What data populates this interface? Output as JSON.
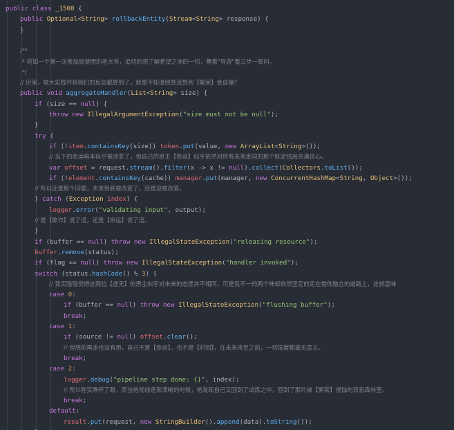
{
  "colors": {
    "background": "#282c34",
    "keyword": "#c678dd",
    "type": "#e5c07b",
    "function": "#61afef",
    "string": "#98c379",
    "comment": "#7f848e",
    "number": "#d19a66",
    "plain": "#abb2bf",
    "identifier": "#e06c75"
  },
  "code_lines": [
    {
      "indent": 0,
      "tokens": [
        {
          "t": "kw",
          "v": "public class "
        },
        {
          "t": "ty",
          "v": "_1500"
        },
        {
          "t": "pl",
          "v": " {"
        }
      ]
    },
    {
      "indent": 1,
      "tokens": [
        {
          "t": "kw",
          "v": "public "
        },
        {
          "t": "ty",
          "v": "Optional"
        },
        {
          "t": "pl",
          "v": "<"
        },
        {
          "t": "ty",
          "v": "String"
        },
        {
          "t": "pl",
          "v": "> "
        },
        {
          "t": "fn",
          "v": "rollbackEntity"
        },
        {
          "t": "pl",
          "v": "("
        },
        {
          "t": "ty",
          "v": "Stream"
        },
        {
          "t": "pl",
          "v": "<"
        },
        {
          "t": "ty",
          "v": "String"
        },
        {
          "t": "pl",
          "v": "> response) {"
        }
      ]
    },
    {
      "indent": 1,
      "tokens": [
        {
          "t": "pl",
          "v": "}"
        }
      ]
    },
    {
      "indent": 0,
      "tokens": []
    },
    {
      "indent": 1,
      "tokens": [
        {
          "t": "cm",
          "v": "/**"
        }
      ]
    },
    {
      "indent": 1,
      "tokens": [
        {
          "t": "cm",
          "v": " * 宛如一个第一次参加旅游团的老大爷，追切的想了解希望之洲的一切，蓦看\"导游\"看三步一顿问。"
        }
      ]
    },
    {
      "indent": 1,
      "tokens": [
        {
          "t": "cm",
          "v": " */"
        }
      ]
    },
    {
      "indent": 1,
      "tokens": [
        {
          "t": "cm",
          "v": "// 厉害，被大实践许将她们的反应都算到了，就是不知道他算没算到【繁荣】会自爆？"
        }
      ]
    },
    {
      "indent": 1,
      "tokens": [
        {
          "t": "kw",
          "v": "public void "
        },
        {
          "t": "fn",
          "v": "aggregateHandler"
        },
        {
          "t": "pl",
          "v": "("
        },
        {
          "t": "ty",
          "v": "List"
        },
        {
          "t": "pl",
          "v": "<"
        },
        {
          "t": "ty",
          "v": "String"
        },
        {
          "t": "pl",
          "v": "> size) {"
        }
      ]
    },
    {
      "indent": 2,
      "tokens": [
        {
          "t": "kw",
          "v": "if "
        },
        {
          "t": "pl",
          "v": "(size == "
        },
        {
          "t": "kw",
          "v": "null"
        },
        {
          "t": "pl",
          "v": ") {"
        }
      ]
    },
    {
      "indent": 3,
      "tokens": [
        {
          "t": "kw",
          "v": "throw new "
        },
        {
          "t": "ty",
          "v": "IllegalArgumentException"
        },
        {
          "t": "pl",
          "v": "("
        },
        {
          "t": "st",
          "v": "\"size must not be null\""
        },
        {
          "t": "pl",
          "v": ");"
        }
      ]
    },
    {
      "indent": 2,
      "tokens": [
        {
          "t": "pl",
          "v": "}"
        }
      ]
    },
    {
      "indent": 2,
      "tokens": [
        {
          "t": "kw",
          "v": "try "
        },
        {
          "t": "pl",
          "v": "{"
        }
      ]
    },
    {
      "indent": 3,
      "tokens": [
        {
          "t": "kw",
          "v": "if "
        },
        {
          "t": "pl",
          "v": "(!"
        },
        {
          "t": "id",
          "v": "item"
        },
        {
          "t": "pl",
          "v": "."
        },
        {
          "t": "fn",
          "v": "containsKey"
        },
        {
          "t": "pl",
          "v": "(size)) "
        },
        {
          "t": "id",
          "v": "token"
        },
        {
          "t": "pl",
          "v": "."
        },
        {
          "t": "fn",
          "v": "put"
        },
        {
          "t": "pl",
          "v": "(value, "
        },
        {
          "t": "kw",
          "v": "new "
        },
        {
          "t": "ty",
          "v": "ArrayList"
        },
        {
          "t": "pl",
          "v": "<"
        },
        {
          "t": "ty",
          "v": "String"
        },
        {
          "t": "pl",
          "v": ">());"
        }
      ]
    },
    {
      "indent": 3,
      "tokens": [
        {
          "t": "cm",
          "v": "// 当下的命运暗本似乎被改变了，但自己的思主【命运】似乎依然对所有未来走向的那个既定结局充满信心。"
        }
      ]
    },
    {
      "indent": 3,
      "tokens": [
        {
          "t": "kw",
          "v": "var "
        },
        {
          "t": "id",
          "v": "offset"
        },
        {
          "t": "pl",
          "v": " = request."
        },
        {
          "t": "fn",
          "v": "stream"
        },
        {
          "t": "pl",
          "v": "()."
        },
        {
          "t": "fn",
          "v": "filter"
        },
        {
          "t": "pl",
          "v": "(x -> x != "
        },
        {
          "t": "kw",
          "v": "null"
        },
        {
          "t": "pl",
          "v": ")."
        },
        {
          "t": "fn",
          "v": "collect"
        },
        {
          "t": "pl",
          "v": "("
        },
        {
          "t": "ty",
          "v": "Collectors"
        },
        {
          "t": "pl",
          "v": "."
        },
        {
          "t": "fn",
          "v": "toList"
        },
        {
          "t": "pl",
          "v": "());"
        }
      ]
    },
    {
      "indent": 3,
      "tokens": [
        {
          "t": "kw",
          "v": "if "
        },
        {
          "t": "pl",
          "v": "(!"
        },
        {
          "t": "id",
          "v": "element"
        },
        {
          "t": "pl",
          "v": "."
        },
        {
          "t": "fn",
          "v": "containsKey"
        },
        {
          "t": "pl",
          "v": "(cache)) "
        },
        {
          "t": "id",
          "v": "manager"
        },
        {
          "t": "pl",
          "v": "."
        },
        {
          "t": "fn",
          "v": "put"
        },
        {
          "t": "pl",
          "v": "(manager, "
        },
        {
          "t": "kw",
          "v": "new "
        },
        {
          "t": "ty",
          "v": "ConcurrentHashMap"
        },
        {
          "t": "pl",
          "v": "<"
        },
        {
          "t": "ty",
          "v": "String"
        },
        {
          "t": "pl",
          "v": ", "
        },
        {
          "t": "ty",
          "v": "Object"
        },
        {
          "t": "pl",
          "v": ">());"
        }
      ]
    },
    {
      "indent": 2,
      "tokens": [
        {
          "t": "cm",
          "v": "// 所以还是那个问题，未来到底被改变了，还是没被改变。"
        }
      ]
    },
    {
      "indent": 2,
      "tokens": [
        {
          "t": "pl",
          "v": "} "
        },
        {
          "t": "kw",
          "v": "catch "
        },
        {
          "t": "pl",
          "v": "("
        },
        {
          "t": "ty",
          "v": "Exception"
        },
        {
          "t": "pl",
          "v": " "
        },
        {
          "t": "id",
          "v": "index"
        },
        {
          "t": "pl",
          "v": ") {"
        }
      ]
    },
    {
      "indent": 3,
      "tokens": [
        {
          "t": "id",
          "v": "logger"
        },
        {
          "t": "pl",
          "v": "."
        },
        {
          "t": "fn",
          "v": "error"
        },
        {
          "t": "pl",
          "v": "("
        },
        {
          "t": "st",
          "v": "\"validating input\""
        },
        {
          "t": "pl",
          "v": ", output);"
        }
      ]
    },
    {
      "indent": 2,
      "tokens": [
        {
          "t": "cm",
          "v": "// 是【欺诈】说了谎，还是【命运】说了谎。"
        }
      ]
    },
    {
      "indent": 2,
      "tokens": [
        {
          "t": "pl",
          "v": "}"
        }
      ]
    },
    {
      "indent": 2,
      "tokens": [
        {
          "t": "kw",
          "v": "if "
        },
        {
          "t": "pl",
          "v": "(buffer == "
        },
        {
          "t": "kw",
          "v": "null"
        },
        {
          "t": "pl",
          "v": ") "
        },
        {
          "t": "kw",
          "v": "throw new "
        },
        {
          "t": "ty",
          "v": "IllegalStateException"
        },
        {
          "t": "pl",
          "v": "("
        },
        {
          "t": "st",
          "v": "\"releasing resource\""
        },
        {
          "t": "pl",
          "v": ");"
        }
      ]
    },
    {
      "indent": 2,
      "tokens": [
        {
          "t": "id",
          "v": "buffer"
        },
        {
          "t": "pl",
          "v": "."
        },
        {
          "t": "fn",
          "v": "remove"
        },
        {
          "t": "pl",
          "v": "(status);"
        }
      ]
    },
    {
      "indent": 2,
      "tokens": [
        {
          "t": "kw",
          "v": "if "
        },
        {
          "t": "pl",
          "v": "(flag == "
        },
        {
          "t": "kw",
          "v": "null"
        },
        {
          "t": "pl",
          "v": ") "
        },
        {
          "t": "kw",
          "v": "throw new "
        },
        {
          "t": "ty",
          "v": "IllegalStateException"
        },
        {
          "t": "pl",
          "v": "("
        },
        {
          "t": "st",
          "v": "\"handler invoked\""
        },
        {
          "t": "pl",
          "v": ");"
        }
      ]
    },
    {
      "indent": 2,
      "tokens": [
        {
          "t": "kw",
          "v": "switch "
        },
        {
          "t": "pl",
          "v": "(status."
        },
        {
          "t": "fn",
          "v": "hashCode"
        },
        {
          "t": "pl",
          "v": "() % "
        },
        {
          "t": "nu",
          "v": "3"
        },
        {
          "t": "pl",
          "v": ") {"
        }
      ]
    },
    {
      "indent": 3,
      "tokens": [
        {
          "t": "cm",
          "v": "// 我实隐隐觉得这两位【虚无】的思主似乎对未来的态度并不相同，可是见不一的两个神却依然坚定的走在借你融合的道路上，这就意味"
        }
      ]
    },
    {
      "indent": 3,
      "tokens": [
        {
          "t": "kw",
          "v": "case "
        },
        {
          "t": "nu",
          "v": "0"
        },
        {
          "t": "pl",
          "v": ":"
        }
      ]
    },
    {
      "indent": 4,
      "tokens": [
        {
          "t": "kw",
          "v": "if "
        },
        {
          "t": "pl",
          "v": "(buffer == "
        },
        {
          "t": "kw",
          "v": "null"
        },
        {
          "t": "pl",
          "v": ") "
        },
        {
          "t": "kw",
          "v": "throw new "
        },
        {
          "t": "ty",
          "v": "IllegalStateException"
        },
        {
          "t": "pl",
          "v": "("
        },
        {
          "t": "st",
          "v": "\"flushing buffer\""
        },
        {
          "t": "pl",
          "v": ");"
        }
      ]
    },
    {
      "indent": 4,
      "tokens": [
        {
          "t": "kw",
          "v": "break"
        },
        {
          "t": "pl",
          "v": ";"
        }
      ]
    },
    {
      "indent": 3,
      "tokens": [
        {
          "t": "kw",
          "v": "case "
        },
        {
          "t": "nu",
          "v": "1"
        },
        {
          "t": "pl",
          "v": ":"
        }
      ]
    },
    {
      "indent": 4,
      "tokens": [
        {
          "t": "kw",
          "v": "if "
        },
        {
          "t": "pl",
          "v": "(source != "
        },
        {
          "t": "kw",
          "v": "null"
        },
        {
          "t": "pl",
          "v": ") "
        },
        {
          "t": "id",
          "v": "offset"
        },
        {
          "t": "pl",
          "v": "."
        },
        {
          "t": "fn",
          "v": "clear"
        },
        {
          "t": "pl",
          "v": "();"
        }
      ]
    },
    {
      "indent": 4,
      "tokens": [
        {
          "t": "cm",
          "v": "// 但想的再多也没有用，自己不是【命运】，也不是【时间】，在未来来至之前，一切揣度都毫无意义。"
        }
      ]
    },
    {
      "indent": 4,
      "tokens": [
        {
          "t": "kw",
          "v": "break"
        },
        {
          "t": "pl",
          "v": ";"
        }
      ]
    },
    {
      "indent": 3,
      "tokens": [
        {
          "t": "kw",
          "v": "case "
        },
        {
          "t": "nu",
          "v": "2"
        },
        {
          "t": "pl",
          "v": ":"
        }
      ]
    },
    {
      "indent": 4,
      "tokens": [
        {
          "t": "id",
          "v": "logger"
        },
        {
          "t": "pl",
          "v": "."
        },
        {
          "t": "fn",
          "v": "debug"
        },
        {
          "t": "pl",
          "v": "("
        },
        {
          "t": "st",
          "v": "\"pipeline step done: {}\""
        },
        {
          "t": "pl",
          "v": ", index);"
        }
      ]
    },
    {
      "indent": 4,
      "tokens": [
        {
          "t": "cm",
          "v": "// 所以程实睁开了眼，而当他视线逐渐清晰的时候，他发现自己又回到了试炼之中，回到了那片被【繁荣】侵蚀的双息森林里。"
        }
      ]
    },
    {
      "indent": 4,
      "tokens": [
        {
          "t": "kw",
          "v": "break"
        },
        {
          "t": "pl",
          "v": ";"
        }
      ]
    },
    {
      "indent": 3,
      "tokens": [
        {
          "t": "kw",
          "v": "default"
        },
        {
          "t": "pl",
          "v": ":"
        }
      ]
    },
    {
      "indent": 4,
      "tokens": [
        {
          "t": "id",
          "v": "result"
        },
        {
          "t": "pl",
          "v": "."
        },
        {
          "t": "fn",
          "v": "put"
        },
        {
          "t": "pl",
          "v": "(request, "
        },
        {
          "t": "kw",
          "v": "new "
        },
        {
          "t": "ty",
          "v": "StringBuilder"
        },
        {
          "t": "pl",
          "v": "()."
        },
        {
          "t": "fn",
          "v": "append"
        },
        {
          "t": "pl",
          "v": "(data)."
        },
        {
          "t": "fn",
          "v": "toString"
        },
        {
          "t": "pl",
          "v": "());"
        }
      ]
    },
    {
      "indent": 2,
      "tokens": [
        {
          "t": "pl",
          "v": "}"
        }
      ]
    }
  ]
}
